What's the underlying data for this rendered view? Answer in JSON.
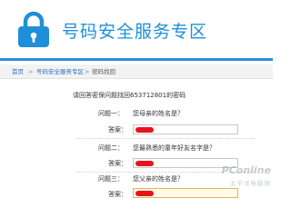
{
  "header": {
    "title": "号码安全服务专区",
    "accent_color": "#1e8fd8",
    "logo_icon": "padlock-icon"
  },
  "breadcrumb": {
    "items": [
      "首页",
      "号码安全服务专区",
      "密码找回"
    ],
    "separator": ">"
  },
  "main": {
    "instruction": "请回答密保问题找回653712801的密码",
    "questions": [
      {
        "label": "问题一：",
        "text": "您母亲的姓名是？",
        "answer_label": "答案："
      },
      {
        "label": "问题二：",
        "text": "您最熟悉的童年好友名字是？",
        "answer_label": "答案："
      },
      {
        "label": "问题三：",
        "text": "您父亲的姓名是？",
        "answer_label": "答案："
      }
    ]
  },
  "watermark": {
    "brand": "PConline",
    "sub": "太平洋电脑网"
  }
}
